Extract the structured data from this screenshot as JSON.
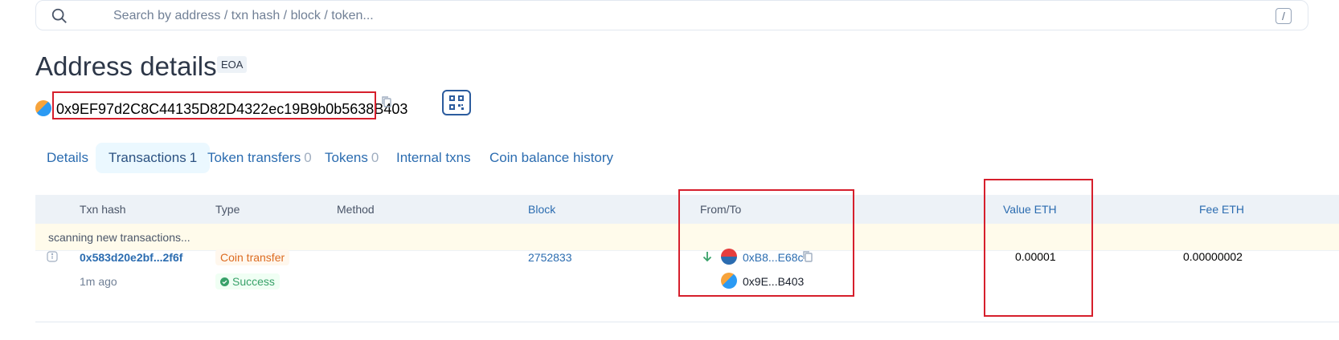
{
  "search": {
    "placeholder": "Search by address / txn hash / block / token...",
    "shortcut": "/"
  },
  "page": {
    "title": "Address details",
    "badge": "EOA"
  },
  "address": {
    "full": "0x9EF97d2C8C44135D82D4322ec19B9b0b5638B403"
  },
  "tabs": [
    {
      "label": "Details",
      "count": ""
    },
    {
      "label": "Transactions",
      "count": "1"
    },
    {
      "label": "Token transfers",
      "count": "0"
    },
    {
      "label": "Tokens",
      "count": "0"
    },
    {
      "label": "Internal txns",
      "count": ""
    },
    {
      "label": "Coin balance history",
      "count": ""
    }
  ],
  "table": {
    "headers": [
      "Txn hash",
      "Type",
      "Method",
      "Block",
      "From/To",
      "Value ETH",
      "Fee ETH"
    ],
    "scanning": "scanning new transactions...",
    "rows": [
      {
        "hash": "0x583d20e2bf...2f6f",
        "age": "1m ago",
        "type": "Coin transfer",
        "status": "Success",
        "method": "",
        "block": "2752833",
        "from": "0xB8...E68c",
        "to": "0x9E...B403",
        "value": "0.00001",
        "fee": "0.00000002"
      }
    ]
  },
  "colors": {
    "accent": "#2b6cb0",
    "highlight": "#d61f2c",
    "success": "#38a169",
    "orange": "#dd6b20"
  },
  "icons": [
    "search-icon",
    "slash-key-icon",
    "copy-icon",
    "qr-code-icon",
    "info-icon",
    "arrow-down-icon",
    "check-circle-icon"
  ]
}
